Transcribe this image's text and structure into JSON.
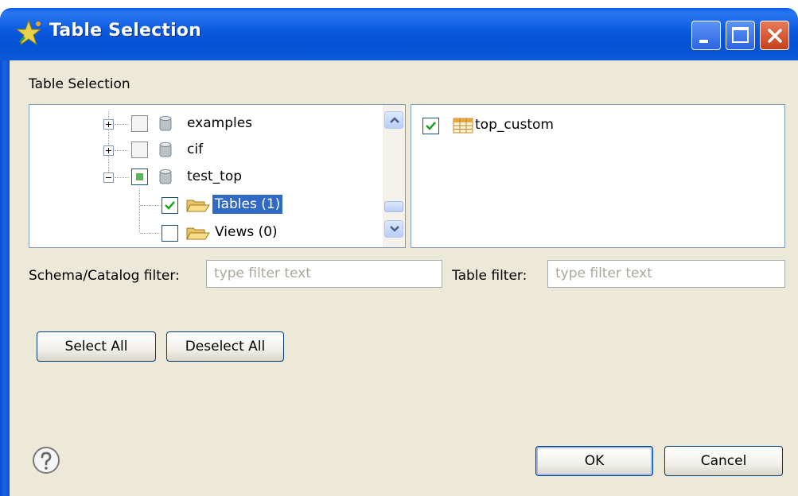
{
  "window": {
    "title": "Table Selection"
  },
  "dialog": {
    "section_label": "Table Selection",
    "tree": [
      {
        "label": "examples",
        "expander": "plus",
        "checked": false,
        "icon": "database-icon"
      },
      {
        "label": "cif",
        "expander": "plus",
        "checked": false,
        "icon": "database-icon"
      },
      {
        "label": "test_top",
        "expander": "minus",
        "checked": "partial",
        "icon": "database-icon"
      },
      {
        "label": "Tables (1)",
        "checked": true,
        "icon": "folder-icon",
        "selected": true
      },
      {
        "label": "Views (0)",
        "checked": false,
        "icon": "folder-icon"
      }
    ],
    "table_list": [
      {
        "label": "top_custom",
        "checked": true,
        "icon": "table-icon"
      }
    ],
    "schema_filter": {
      "label": "Schema/Catalog filter:",
      "placeholder": "type filter text"
    },
    "table_filter": {
      "label": "Table filter:",
      "placeholder": "type filter text"
    },
    "buttons": {
      "select_all": "Select All",
      "deselect_all": "Deselect All",
      "ok": "OK",
      "cancel": "Cancel"
    }
  },
  "colors": {
    "titlebar": "#0a58de",
    "dialog_bg": "#ece9d8",
    "selection": "#316ac5",
    "close_button": "#c5401b"
  }
}
